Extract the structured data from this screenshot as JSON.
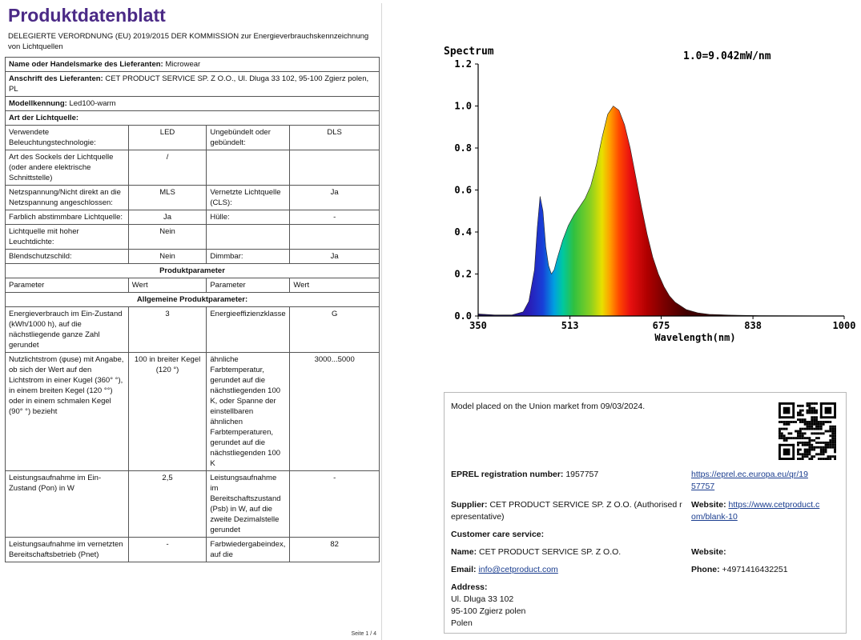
{
  "sheet": {
    "title": "Produktdatenblatt",
    "subtitle": "DELEGIERTE VERORDNUNG (EU) 2019/2015 DER KOMMISSION zur Energieverbrauchskennzeichnung von Lichtquellen",
    "supplier_label": "Name oder Handelsmarke des Lieferanten:",
    "supplier_value": "Microwear",
    "address_label": "Anschrift des Lieferanten:",
    "address_value": "CET PRODUCT SERVICE SP. Z O.O., Ul. Dluga 33 102, 95-100 Zgierz polen, PL",
    "model_label": "Modellkennung:",
    "model_value": "Led100-warm",
    "source_type_label": "Art der Lichtquelle:",
    "rows_a": [
      [
        "Verwendete Beleuchtungstechnologie:",
        "LED",
        "Ungebündelt oder gebündelt:",
        "DLS"
      ],
      [
        "Art des Sockels der Lichtquelle (oder andere elektrische Schnittstelle)",
        "/",
        "",
        ""
      ],
      [
        "Netzspannung/Nicht direkt an die Netzspannung angeschlossen:",
        "MLS",
        "Vernetzte Lichtquelle (CLS):",
        "Ja"
      ],
      [
        "Farblich abstimmbare Lichtquelle:",
        "Ja",
        "Hülle:",
        "-"
      ],
      [
        "Lichtquelle mit hoher Leuchtdichte:",
        "Nein",
        "",
        ""
      ],
      [
        "Blendschutzschild:",
        "Nein",
        "Dimmbar:",
        "Ja"
      ]
    ],
    "produktparameter": "Produktparameter",
    "col_headers": [
      "Parameter",
      "Wert",
      "Parameter",
      "Wert"
    ],
    "allgemeine": "Allgemeine Produktparameter:",
    "rows_b": [
      [
        "Energieverbrauch im Ein-Zustand (kWh/1000 h), auf die nächstliegende ganze Zahl gerundet",
        "3",
        "Energieeffizienzklasse",
        "G"
      ],
      [
        "Nutzlichtstrom (φuse) mit Angabe, ob sich der Wert auf den Lichtstrom in einer Kugel (360° °), in einem breiten Kegel (120 °°) oder in einem schmalen Kegel (90° °) bezieht",
        "100 in breiter Kegel (120 °)",
        "ähnliche Farbtemperatur, gerundet auf die nächstliegenden 100 K, oder Spanne der einstellbaren ähnlichen Farbtemperaturen, gerundet auf die nächstliegenden 100 K",
        "3000...5000"
      ],
      [
        "Leistungsaufnahme im Ein-Zustand (Pon) in W",
        "2,5",
        "Leistungsaufnahme im Bereitschaftszustand (Psb) in W, auf die zweite Dezimalstelle gerundet",
        "-"
      ],
      [
        "Leistungsaufnahme im vernetzten Bereitschaftsbetrieb (Pnet)",
        "-",
        "Farbwiedergabeindex, auf die",
        "82"
      ]
    ],
    "page_number": "Seite 1 / 4"
  },
  "chart_data": {
    "type": "line",
    "title": "Spectrum",
    "annotation": "1.0=9.042mW/nm",
    "xlabel": "Wavelength(nm)",
    "ylabel": "",
    "x_ticks": [
      "350",
      "513",
      "675",
      "838",
      "1000"
    ],
    "y_ticks": [
      "0.0",
      "0.2",
      "0.4",
      "0.6",
      "0.8",
      "1.0",
      "1.2"
    ],
    "xlim": [
      350,
      1000
    ],
    "ylim": [
      0,
      1.2
    ],
    "grid": false,
    "series": [
      {
        "x": [
          350,
          380,
          410,
          430,
          440,
          450,
          455,
          460,
          465,
          470,
          475,
          480,
          485,
          490,
          500,
          510,
          520,
          530,
          540,
          550,
          560,
          570,
          580,
          590,
          600,
          610,
          620,
          630,
          640,
          650,
          660,
          670,
          680,
          690,
          700,
          720,
          740,
          760,
          800,
          850,
          900,
          1000
        ],
        "y": [
          0.01,
          0.005,
          0.005,
          0.02,
          0.07,
          0.22,
          0.42,
          0.57,
          0.5,
          0.33,
          0.24,
          0.2,
          0.22,
          0.27,
          0.36,
          0.43,
          0.48,
          0.52,
          0.56,
          0.62,
          0.72,
          0.85,
          0.96,
          1.0,
          0.98,
          0.91,
          0.8,
          0.66,
          0.52,
          0.39,
          0.28,
          0.2,
          0.14,
          0.095,
          0.065,
          0.03,
          0.015,
          0.008,
          0.004,
          0.002,
          0.001,
          0.0
        ]
      }
    ]
  },
  "card": {
    "market_text": "Model placed on the Union market from 09/03/2024.",
    "eprel_label": "EPREL registration number:",
    "eprel_value": "1957757",
    "eprel_link_1": "https://eprel.ec.europa.eu/qr/19",
    "eprel_link_2": "57757",
    "supplier_label": "Supplier:",
    "supplier_value_1": "CET PRODUCT SERVICE SP. Z O.O. (Authorised r",
    "supplier_value_2": "epresentative)",
    "website_label": "Website:",
    "website_value_1": "https://www.cetproduct.c",
    "website_value_2": "om/blank-10",
    "care_label": "Customer care service:",
    "name_label": "Name:",
    "name_value": "CET PRODUCT SERVICE SP. Z O.O.",
    "website2_label": "Website:",
    "email_label": "Email:",
    "email_value": "info@cetproduct.com",
    "phone_label": "Phone:",
    "phone_value": "+4971416432251",
    "address_label": "Address:",
    "address_1": "Ul. Dluga 33 102",
    "address_2": "95-100 Zgierz polen",
    "address_3": "Polen"
  }
}
